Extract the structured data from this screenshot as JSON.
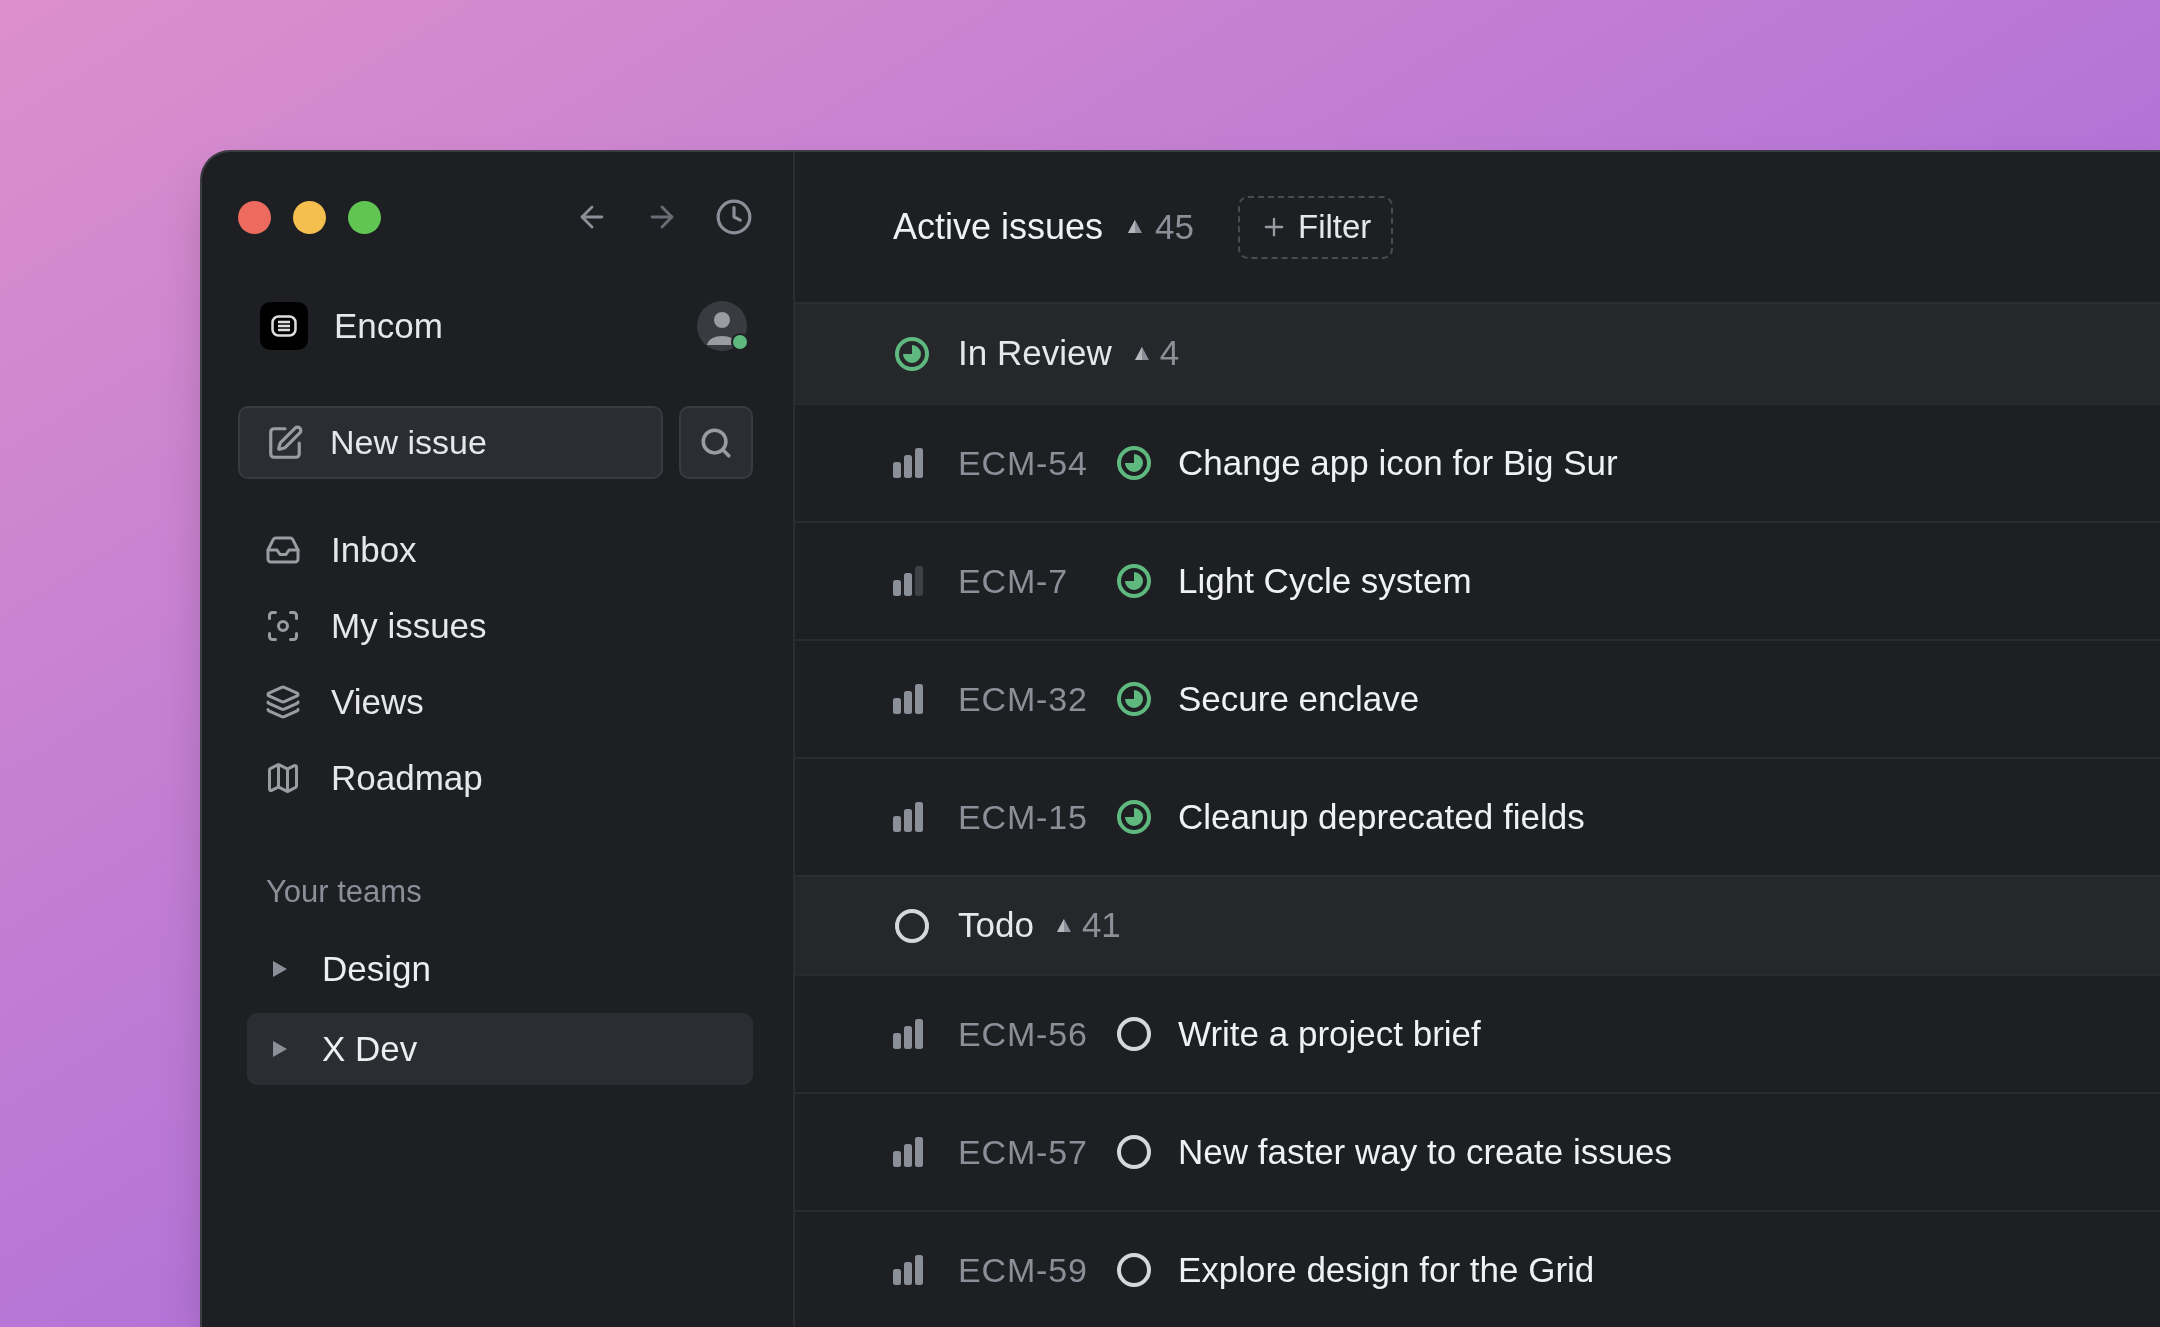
{
  "sidebar": {
    "workspace": "Encom",
    "user": {
      "online": true
    },
    "new_issue_button": "New issue",
    "nav": [
      {
        "kind": "inbox",
        "label": "Inbox"
      },
      {
        "kind": "my_issues",
        "label": "My issues"
      },
      {
        "kind": "views",
        "label": "Views"
      },
      {
        "kind": "roadmap",
        "label": "Roadmap"
      }
    ],
    "teams_title": "Your teams",
    "teams": [
      {
        "label": "Design",
        "expanded": false,
        "selected": false
      },
      {
        "label": "X Dev",
        "expanded": false,
        "selected": true
      }
    ]
  },
  "main": {
    "title": "Active issues",
    "count": "45",
    "filter_button": "Filter",
    "groups": [
      {
        "kind": "in_review",
        "label": "In Review",
        "count": "4",
        "issues": [
          {
            "priority": {
              "kind": "high"
            },
            "id": "ECM-54",
            "kind": "in_review",
            "title": "Change app icon for Big Sur"
          },
          {
            "priority": {
              "kind": "medium"
            },
            "id": "ECM-7",
            "kind": "in_review",
            "title": "Light Cycle system"
          },
          {
            "priority": {
              "kind": "high"
            },
            "id": "ECM-32",
            "kind": "in_review",
            "title": "Secure enclave"
          },
          {
            "priority": {
              "kind": "high"
            },
            "id": "ECM-15",
            "kind": "in_review",
            "title": "Cleanup deprecated fields"
          }
        ]
      },
      {
        "kind": "todo",
        "label": "Todo",
        "count": "41",
        "issues": [
          {
            "priority": {
              "kind": "high"
            },
            "id": "ECM-56",
            "kind": "todo",
            "title": "Write a project brief"
          },
          {
            "priority": {
              "kind": "high"
            },
            "id": "ECM-57",
            "kind": "todo",
            "title": "New faster way to create issues"
          },
          {
            "priority": {
              "kind": "high"
            },
            "id": "ECM-59",
            "kind": "todo",
            "title": "Explore design for the Grid"
          }
        ]
      }
    ]
  }
}
